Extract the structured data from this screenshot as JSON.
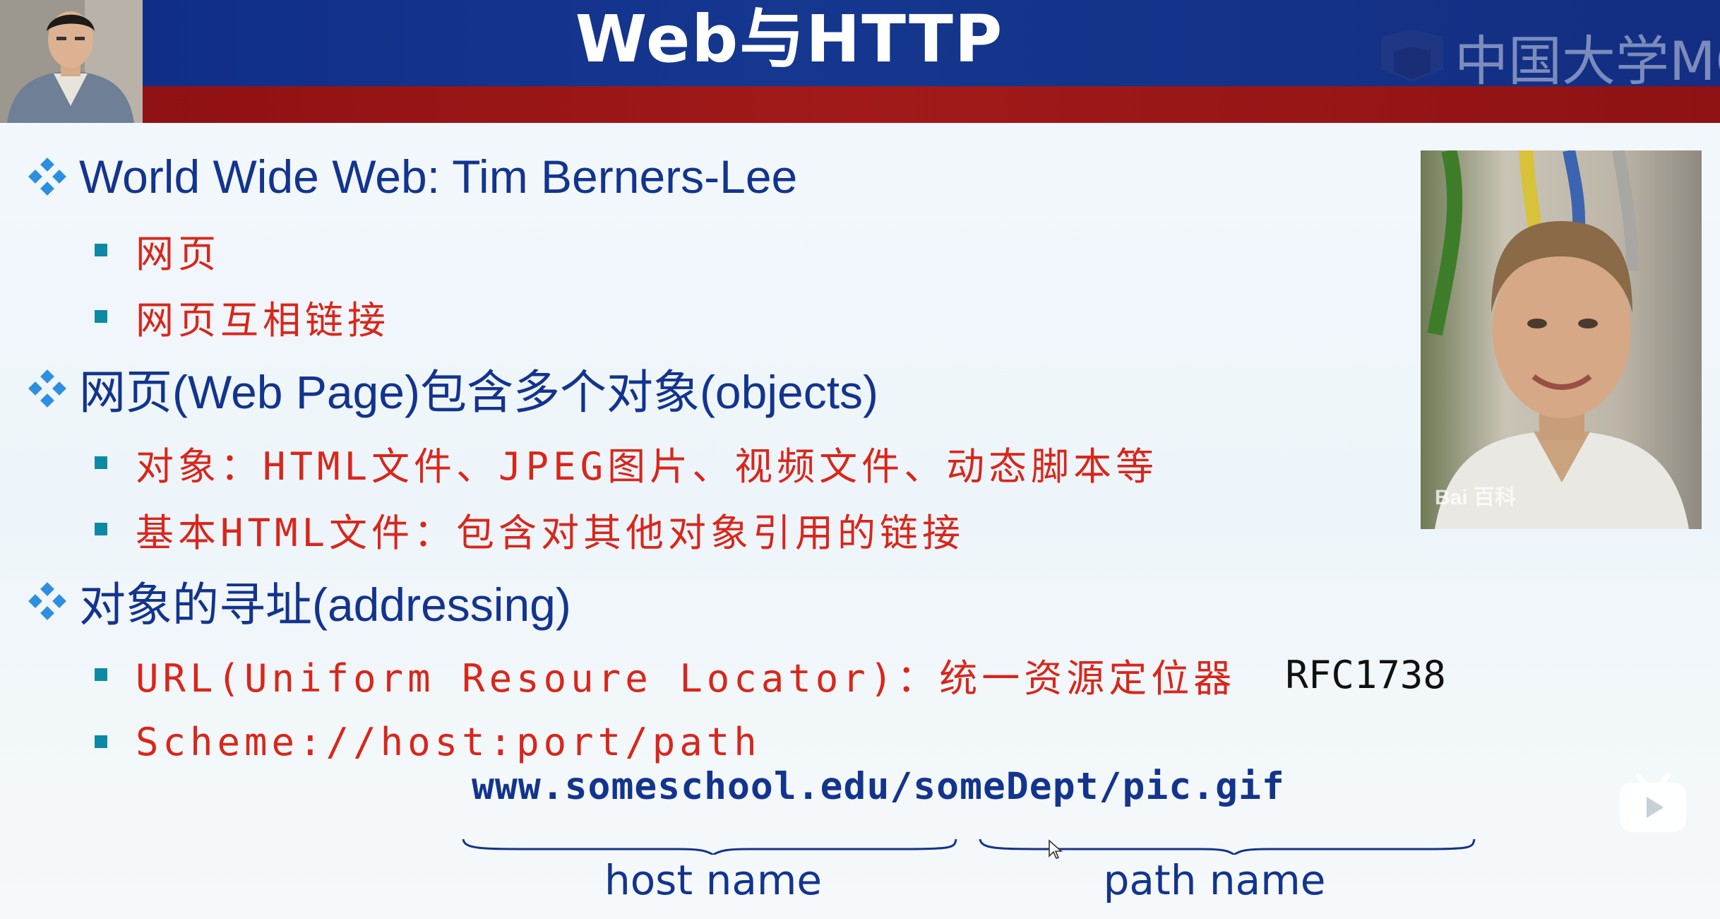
{
  "slide": {
    "title": "Web与HTTP",
    "logo_text": "中国大学MOOC",
    "photo_watermark": "Bai 百科",
    "bullets": [
      {
        "text": "World Wide Web: Tim Berners-Lee",
        "subitems": [
          "网页",
          "网页互相链接"
        ]
      },
      {
        "text": "网页(Web Page)包含多个对象(objects)",
        "subitems": [
          "对象：HTML文件、JPEG图片、视频文件、动态脚本等",
          "基本HTML文件：包含对其他对象引用的链接"
        ]
      },
      {
        "text": "对象的寻址(addressing)",
        "subitems": [
          "URL(Uniform Resoure Locator)：统一资源定位器",
          "Scheme://host:port/path"
        ],
        "rfc": "RFC1738"
      }
    ],
    "url_example": "www.someschool.edu/someDept/pic.gif",
    "host_label": "host name",
    "path_label": "path name"
  },
  "colors": {
    "header_blue": "#13348e",
    "header_red": "#9a1617",
    "bullet_l1_text": "#13348e",
    "bullet_l2_text": "#d9261b",
    "bullet_l2_marker": "#0d8aa3",
    "diamond": "#2d8fe0"
  },
  "icons": [
    "diamond-bullet-icon",
    "square-bullet-icon",
    "play-icon",
    "cursor-icon",
    "mooc-logo-icon"
  ]
}
